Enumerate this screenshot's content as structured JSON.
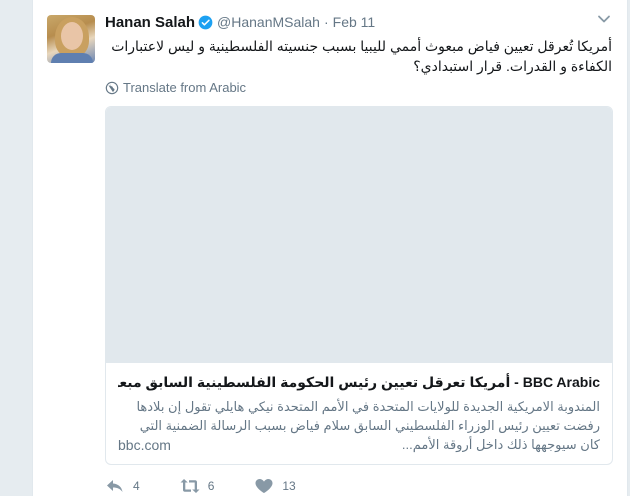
{
  "tweet": {
    "author_name": "Hanan Salah",
    "handle": "@HananMSalah",
    "separator": "·",
    "date": "Feb 11",
    "text": "أمريكا تُعرقل تعيين فياض مبعوث أممي لليبيا بسبب جنسيته الفلسطينية و ليس لاعتبارات الكفاءة و القدرات. قرار استبدادي؟",
    "translate_label": "Translate from Arabic",
    "card": {
      "title": "BBC Arabic - أمريكا تعرقل تعيين رئيس الحكومة الفلسطينية السابق مبعوثا دوليا لليبيا",
      "description": "المندوبة الامريكية الجديدة للولايات المتحدة في الأمم المتحدة نيكي هايلي تقول إن بلادها رفضت تعيين رئيس الوزراء الفلسطيني السابق سلام فياض بسبب الرسالة الضمنية التي كان سيوجهها ذلك داخل أروقة الأمم...",
      "domain": "bbc.com"
    },
    "actions": {
      "reply_count": "4",
      "retweet_count": "6",
      "like_count": "13"
    }
  },
  "colors": {
    "background": "#e6ecf0",
    "verified_blue": "#1da1f2",
    "muted_text": "#657786"
  },
  "icons": [
    "verified-icon",
    "chevron-down-icon",
    "globe-icon",
    "reply-icon",
    "retweet-icon",
    "like-icon"
  ]
}
